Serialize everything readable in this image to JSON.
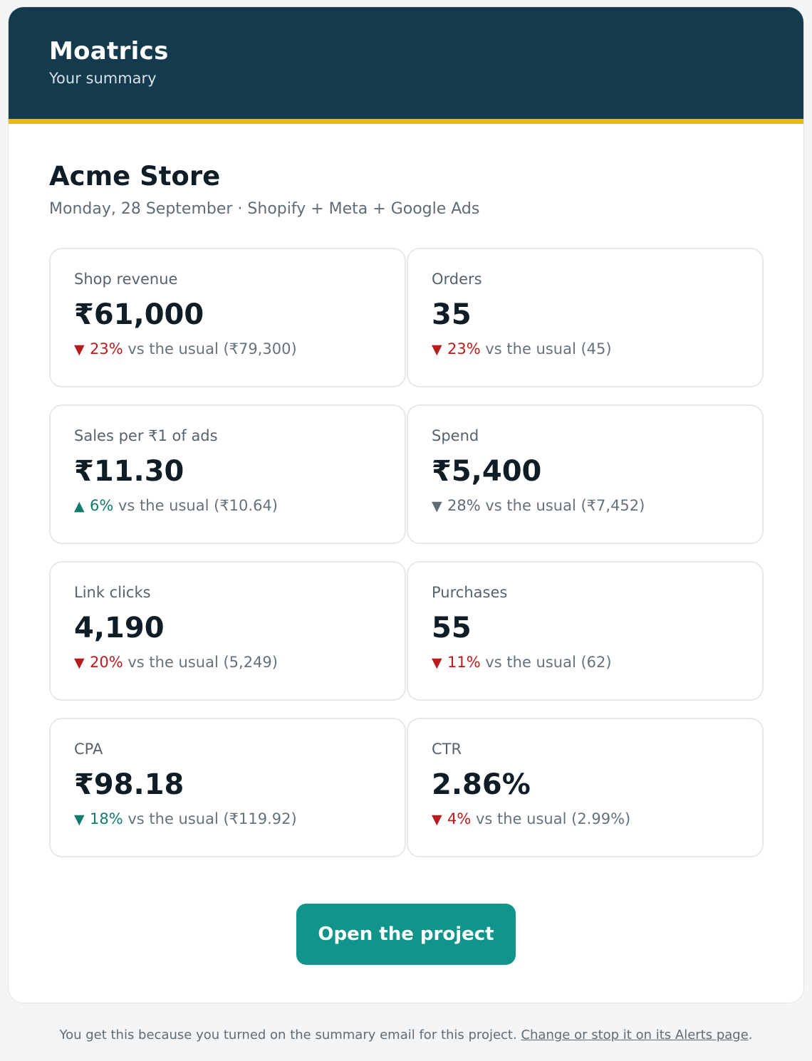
{
  "header": {
    "brand": "Moatrics",
    "tagline": "Your summary"
  },
  "store": {
    "name": "Acme Store",
    "meta": "Monday, 28 September · Shopify + Meta + Google Ads"
  },
  "colors": {
    "header_bg": "#133a4d",
    "accent": "#e8b81a",
    "negative": "#b91c1c",
    "positive": "#0f7c6d",
    "neutral": "#5f6c75",
    "button": "#11958a"
  },
  "metrics": [
    {
      "label": "Shop revenue",
      "value": "₹61,000",
      "arrow": "▼",
      "pct": "23%",
      "rest": " vs the usual (₹79,300)",
      "tone": "neg",
      "icon": "triangle-down-icon"
    },
    {
      "label": "Orders",
      "value": "35",
      "arrow": "▼",
      "pct": "23%",
      "rest": " vs the usual (45)",
      "tone": "neg",
      "icon": "triangle-down-icon"
    },
    {
      "label": "Sales per ₹1 of ads",
      "value": "₹11.30",
      "arrow": "▲",
      "pct": "6%",
      "rest": " vs the usual (₹10.64)",
      "tone": "pos",
      "icon": "triangle-up-icon"
    },
    {
      "label": "Spend",
      "value": "₹5,400",
      "arrow": "▼",
      "pct": "28%",
      "rest": " vs the usual (₹7,452)",
      "tone": "neu",
      "icon": "triangle-down-icon"
    },
    {
      "label": "Link clicks",
      "value": "4,190",
      "arrow": "▼",
      "pct": "20%",
      "rest": " vs the usual (5,249)",
      "tone": "neg",
      "icon": "triangle-down-icon"
    },
    {
      "label": "Purchases",
      "value": "55",
      "arrow": "▼",
      "pct": "11%",
      "rest": " vs the usual (62)",
      "tone": "neg",
      "icon": "triangle-down-icon"
    },
    {
      "label": "CPA",
      "value": "₹98.18",
      "arrow": "▼",
      "pct": "18%",
      "rest": " vs the usual (₹119.92)",
      "tone": "pos",
      "icon": "triangle-down-icon"
    },
    {
      "label": "CTR",
      "value": "2.86%",
      "arrow": "▼",
      "pct": "4%",
      "rest": " vs the usual (2.99%)",
      "tone": "neg",
      "icon": "triangle-down-icon"
    }
  ],
  "cta": {
    "label": "Open the project"
  },
  "footer": {
    "text": "You get this because you turned on the summary email for this project. ",
    "link": "Change or stop it on its Alerts page",
    "end": "."
  }
}
